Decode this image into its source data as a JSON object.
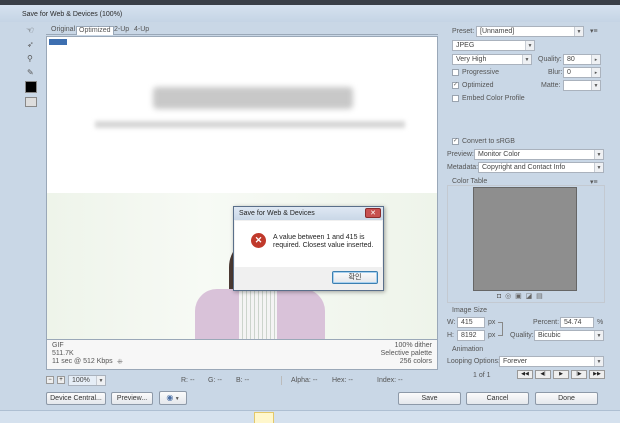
{
  "window": {
    "title": "Save for Web & Devices (100%)"
  },
  "tabs": [
    {
      "label": "Original",
      "active": false
    },
    {
      "label": "Optimized",
      "active": true
    },
    {
      "label": "2-Up",
      "active": false
    },
    {
      "label": "4-Up",
      "active": false
    }
  ],
  "tools": [
    "hand-tool-icon",
    "slice-select-tool-icon",
    "zoom-tool-icon",
    "eyedropper-tool-icon",
    "eyedropper-color-swatch-icon",
    "toggle-slices-icon"
  ],
  "info_left": {
    "format": "GIF",
    "size": "511.7K",
    "time": "11 sec @ 512 Kbps"
  },
  "info_right": {
    "dither": "100% dither",
    "palette": "Selective palette",
    "colors": "256 colors"
  },
  "zoom": "100%",
  "readouts": [
    {
      "label": "R: --"
    },
    {
      "label": "G: --"
    },
    {
      "label": "B: --"
    },
    {
      "label": "Alpha: --"
    },
    {
      "label": "Hex: --"
    },
    {
      "label": "Index: --"
    }
  ],
  "buttons": {
    "device_central": "Device Central...",
    "preview": "Preview...",
    "save": "Save",
    "cancel": "Cancel",
    "done": "Done"
  },
  "settings": {
    "preset_label": "Preset:",
    "preset_value": "[Unnamed]",
    "format": "JPEG",
    "quality_level": "Very High",
    "quality_label": "Quality:",
    "quality_value": "80",
    "progressive": "Progressive",
    "blur_label": "Blur:",
    "blur_value": "0",
    "optimized": "Optimized",
    "matte_label": "Matte:",
    "embed_profile": "Embed Color Profile",
    "convert_srgb": "Convert to sRGB",
    "preview_label": "Preview:",
    "preview_value": "Monitor Color",
    "metadata_label": "Metadata:",
    "metadata_value": "Copyright and Contact Info",
    "color_table": "Color Table"
  },
  "image_size": {
    "heading": "Image Size",
    "w_label": "W:",
    "w_value": "415",
    "w_unit": "px",
    "h_label": "H:",
    "h_value": "8192",
    "h_unit": "px",
    "percent_label": "Percent:",
    "percent_value": "54.74",
    "percent_unit": "%",
    "quality_label": "Quality:",
    "quality_value": "Bicubic"
  },
  "animation": {
    "heading": "Animation",
    "looping_label": "Looping Options:",
    "looping_value": "Forever",
    "frame": "1 of 1"
  },
  "dialog": {
    "title": "Save for Web & Devices",
    "message_line1": "A value between 1 and 415 is",
    "message_line2": "required. Closest value inserted.",
    "ok": "확인"
  },
  "colors": {
    "accent": "#c0392b",
    "window_frame": "#c9d7e6",
    "panel": "#f3f3f3"
  }
}
